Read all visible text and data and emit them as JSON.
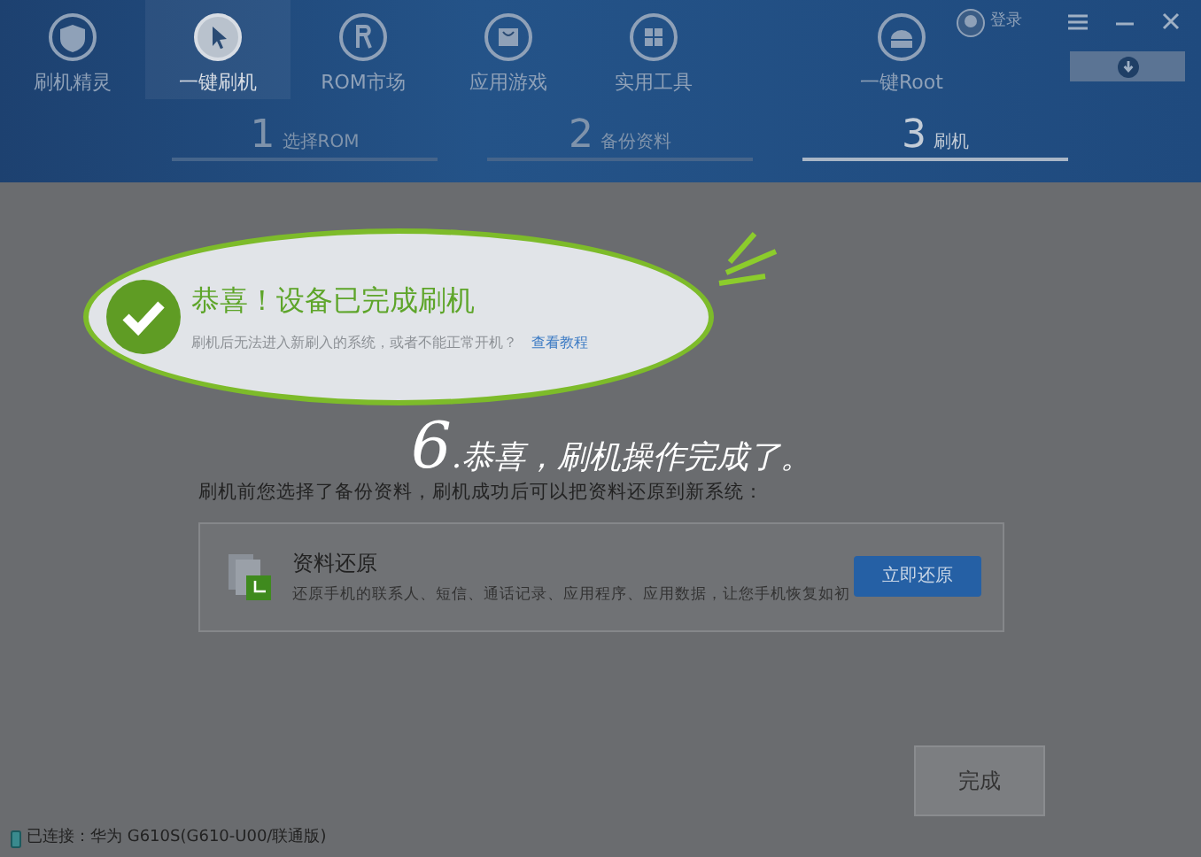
{
  "nav_items": [
    {
      "label": "刷机精灵",
      "selected": false
    },
    {
      "label": "一键刷机",
      "selected": true
    },
    {
      "label": "ROM市场",
      "selected": false
    },
    {
      "label": "应用游戏",
      "selected": false
    },
    {
      "label": "实用工具",
      "selected": false
    },
    {
      "label": "一键Root",
      "selected": false
    }
  ],
  "login": "登录",
  "steps": [
    {
      "number": "1",
      "label": "选择ROM",
      "selected": false
    },
    {
      "number": "2",
      "label": "备份资料",
      "selected": false
    },
    {
      "number": "3",
      "label": "刷机",
      "selected": true
    }
  ],
  "result": {
    "title": "恭喜！设备已完成刷机",
    "message": "刷机后无法进入新刷入的系统，或者不能正常开机？",
    "link": "查看教程"
  },
  "annotation": "6.恭喜，刷机操作完成了。",
  "restore_intro": "刷机前您选择了备份资料，刷机成功后可以把资料还原到新系统：",
  "restore": {
    "title": "资料还原",
    "description": "还原手机的联系人、短信、通话记录、应用程序、应用数据，让您手机恢复如初",
    "button": "立即还原"
  },
  "finish_button": "完成",
  "status_bar": "已连接：华为 G610S(G610-U00/联通版)"
}
